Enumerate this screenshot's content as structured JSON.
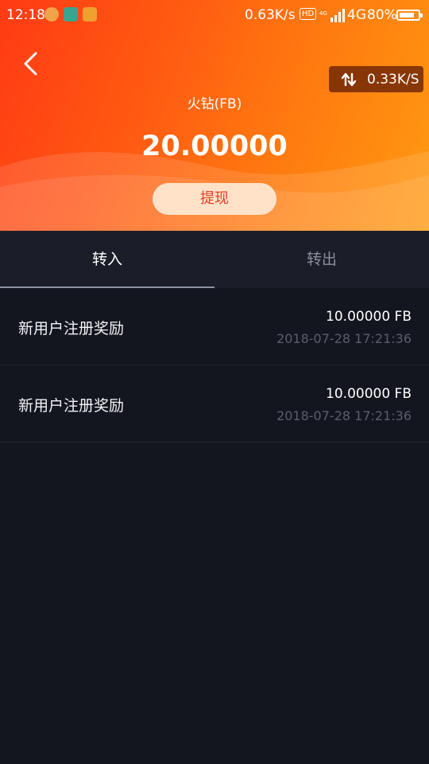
{
  "status_bar": {
    "time": "12:18",
    "network_speed": "0.63K/s",
    "hd": "HD",
    "network_type": "4G",
    "battery_pct": "80%",
    "battery_level": 0.8
  },
  "header": {
    "speed_label": "0.33K/S",
    "coin_name": "火钻(FB)",
    "balance": "20.00000",
    "withdraw_label": "提现",
    "gradient_start": "#ff3a14",
    "gradient_end": "#ff9a12"
  },
  "tabs": [
    {
      "label": "转入",
      "active": true
    },
    {
      "label": "转出",
      "active": false
    }
  ],
  "transactions": [
    {
      "title": "新用户注册奖励",
      "amount": "10.00000  FB",
      "time": "2018-07-28 17:21:36"
    },
    {
      "title": "新用户注册奖励",
      "amount": "10.00000  FB",
      "time": "2018-07-28 17:21:36"
    }
  ]
}
